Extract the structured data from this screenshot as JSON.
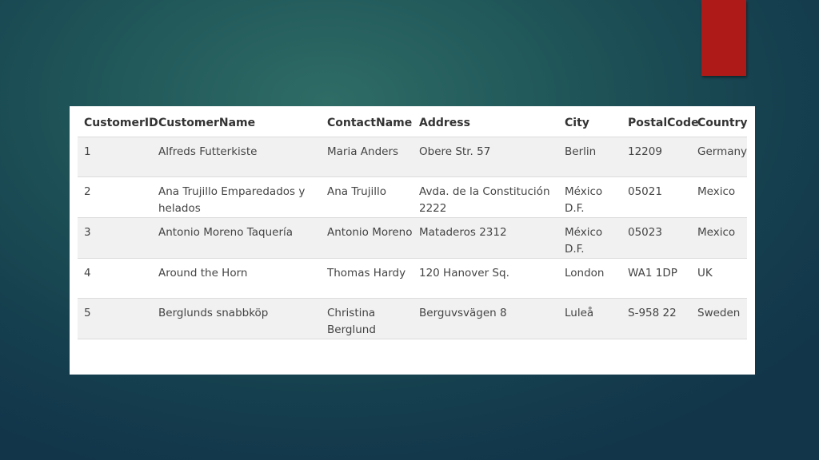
{
  "table": {
    "headers": [
      "CustomerID",
      "CustomerName",
      "ContactName",
      "Address",
      "City",
      "PostalCode",
      "Country"
    ],
    "rows": [
      [
        "1",
        "Alfreds Futterkiste",
        "Maria Anders",
        "Obere Str. 57",
        "Berlin",
        "12209",
        "Germany"
      ],
      [
        "2",
        "Ana Trujillo Emparedados y helados",
        "Ana Trujillo",
        "Avda. de la Constitución 2222",
        "México D.F.",
        "05021",
        "Mexico"
      ],
      [
        "3",
        "Antonio Moreno Taquería",
        "Antonio Moreno",
        "Mataderos 2312",
        "México D.F.",
        "05023",
        "Mexico"
      ],
      [
        "4",
        "Around the Horn",
        "Thomas Hardy",
        "120 Hanover Sq.",
        "London",
        "WA1 1DP",
        "UK"
      ],
      [
        "5",
        "Berglunds snabbköp",
        "Christina Berglund",
        "Berguvsvägen 8",
        "Luleå",
        "S-958 22",
        "Sweden"
      ]
    ]
  },
  "colors": {
    "accent_tab": "#ad1a17",
    "background": "#1f5558"
  }
}
